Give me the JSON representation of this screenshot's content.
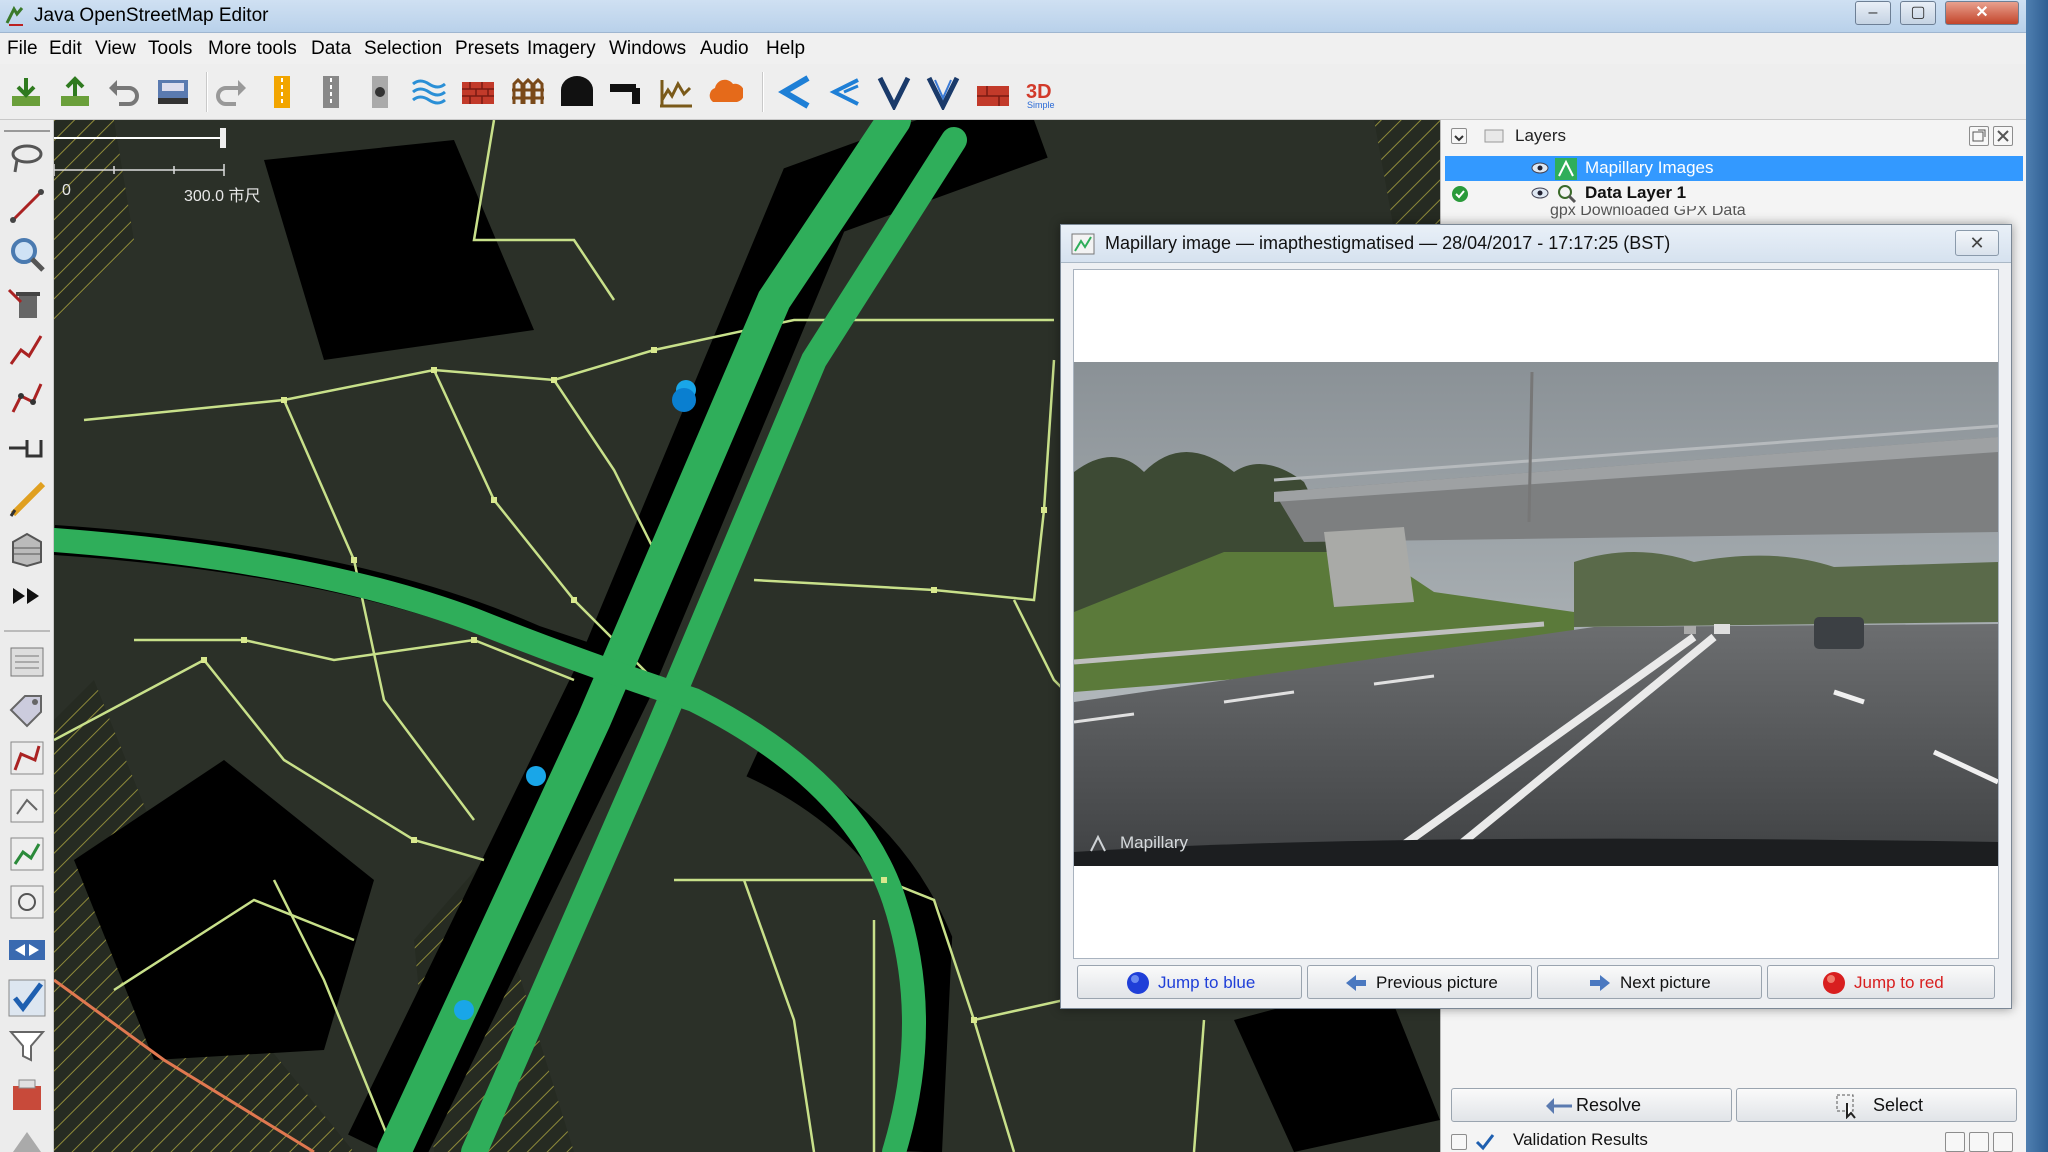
{
  "window": {
    "title": "Java OpenStreetMap Editor",
    "minimize": "–",
    "maximize": "▢",
    "close": "✕"
  },
  "menu": [
    "File",
    "Edit",
    "View",
    "Tools",
    "More tools",
    "Data",
    "Selection",
    "Presets",
    "Imagery",
    "Windows",
    "Audio",
    "Help"
  ],
  "toolbar_icons": [
    "download-icon",
    "upload-icon",
    "undo-icon",
    "save-icon",
    "redo-icon",
    "preset-1-icon",
    "preset-2-icon",
    "preset-3-icon",
    "waterway-icon",
    "wall-icon",
    "fence-icon",
    "tunnel-icon",
    "bridge-icon",
    "terrain-icon",
    "cloud-icon",
    "merge-icon",
    "split-icon",
    "v-icon-1",
    "v-icon-2",
    "brick-icon",
    "3d-icon"
  ],
  "map": {
    "scale_start": "0",
    "scale_end": "300.0 市尺"
  },
  "layers": {
    "title": "Layers",
    "items": [
      {
        "name": "Mapillary Images",
        "selected": true,
        "bold": false
      },
      {
        "name": "Data Layer 1",
        "selected": false,
        "bold": true
      },
      {
        "name": "gpx Downloaded GPX Data",
        "selected": false,
        "bold": false
      }
    ]
  },
  "mapillary_dialog": {
    "title": "Mapillary image — imapthestigmatised — 28/04/2017 - 17:17:25 (BST)",
    "watermark": "Mapillary",
    "buttons": {
      "jump_blue": "Jump to blue",
      "previous": "Previous picture",
      "next": "Next picture",
      "jump_red": "Jump to red"
    }
  },
  "validation": {
    "resolve": "Resolve",
    "select": "Select",
    "title": "Validation Results"
  },
  "colors": {
    "accent": "#3399ff",
    "sequence_green": "#2fae5a",
    "map_background": "#2a2f28",
    "way_lines": "#c8e08a"
  }
}
